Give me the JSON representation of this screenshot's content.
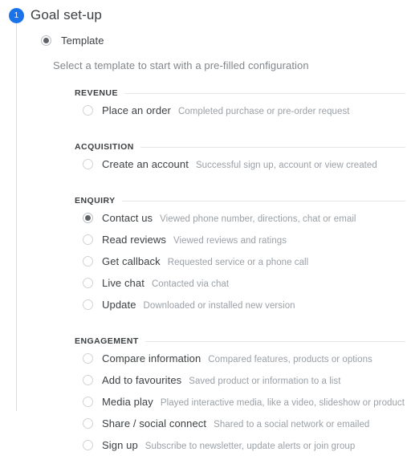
{
  "step": {
    "number": "1",
    "title": "Goal set-up",
    "badge_color": "#1a73e8"
  },
  "mode": {
    "label": "Template",
    "selected": true,
    "helper_text": "Select a template to start with a pre-filled configuration"
  },
  "groups": [
    {
      "title": "REVENUE",
      "options": [
        {
          "label": "Place an order",
          "desc": "Completed purchase or pre-order request",
          "selected": false
        }
      ]
    },
    {
      "title": "ACQUISITION",
      "options": [
        {
          "label": "Create an account",
          "desc": "Successful sign up, account or view created",
          "selected": false
        }
      ]
    },
    {
      "title": "ENQUIRY",
      "options": [
        {
          "label": "Contact us",
          "desc": "Viewed phone number, directions, chat or email",
          "selected": true
        },
        {
          "label": "Read reviews",
          "desc": "Viewed reviews and ratings",
          "selected": false
        },
        {
          "label": "Get callback",
          "desc": "Requested service or a phone call",
          "selected": false
        },
        {
          "label": "Live chat",
          "desc": "Contacted via chat",
          "selected": false
        },
        {
          "label": "Update",
          "desc": "Downloaded or installed new version",
          "selected": false
        }
      ]
    },
    {
      "title": "ENGAGEMENT",
      "options": [
        {
          "label": "Compare information",
          "desc": "Compared features, products or options",
          "selected": false
        },
        {
          "label": "Add to favourites",
          "desc": "Saved product or information to a list",
          "selected": false
        },
        {
          "label": "Media play",
          "desc": "Played interactive media, like a video, slideshow or product demo",
          "selected": false
        },
        {
          "label": "Share / social connect",
          "desc": "Shared to a social network or emailed",
          "selected": false
        },
        {
          "label": "Sign up",
          "desc": "Subscribe to newsletter, update alerts or join group",
          "selected": false
        }
      ]
    }
  ]
}
